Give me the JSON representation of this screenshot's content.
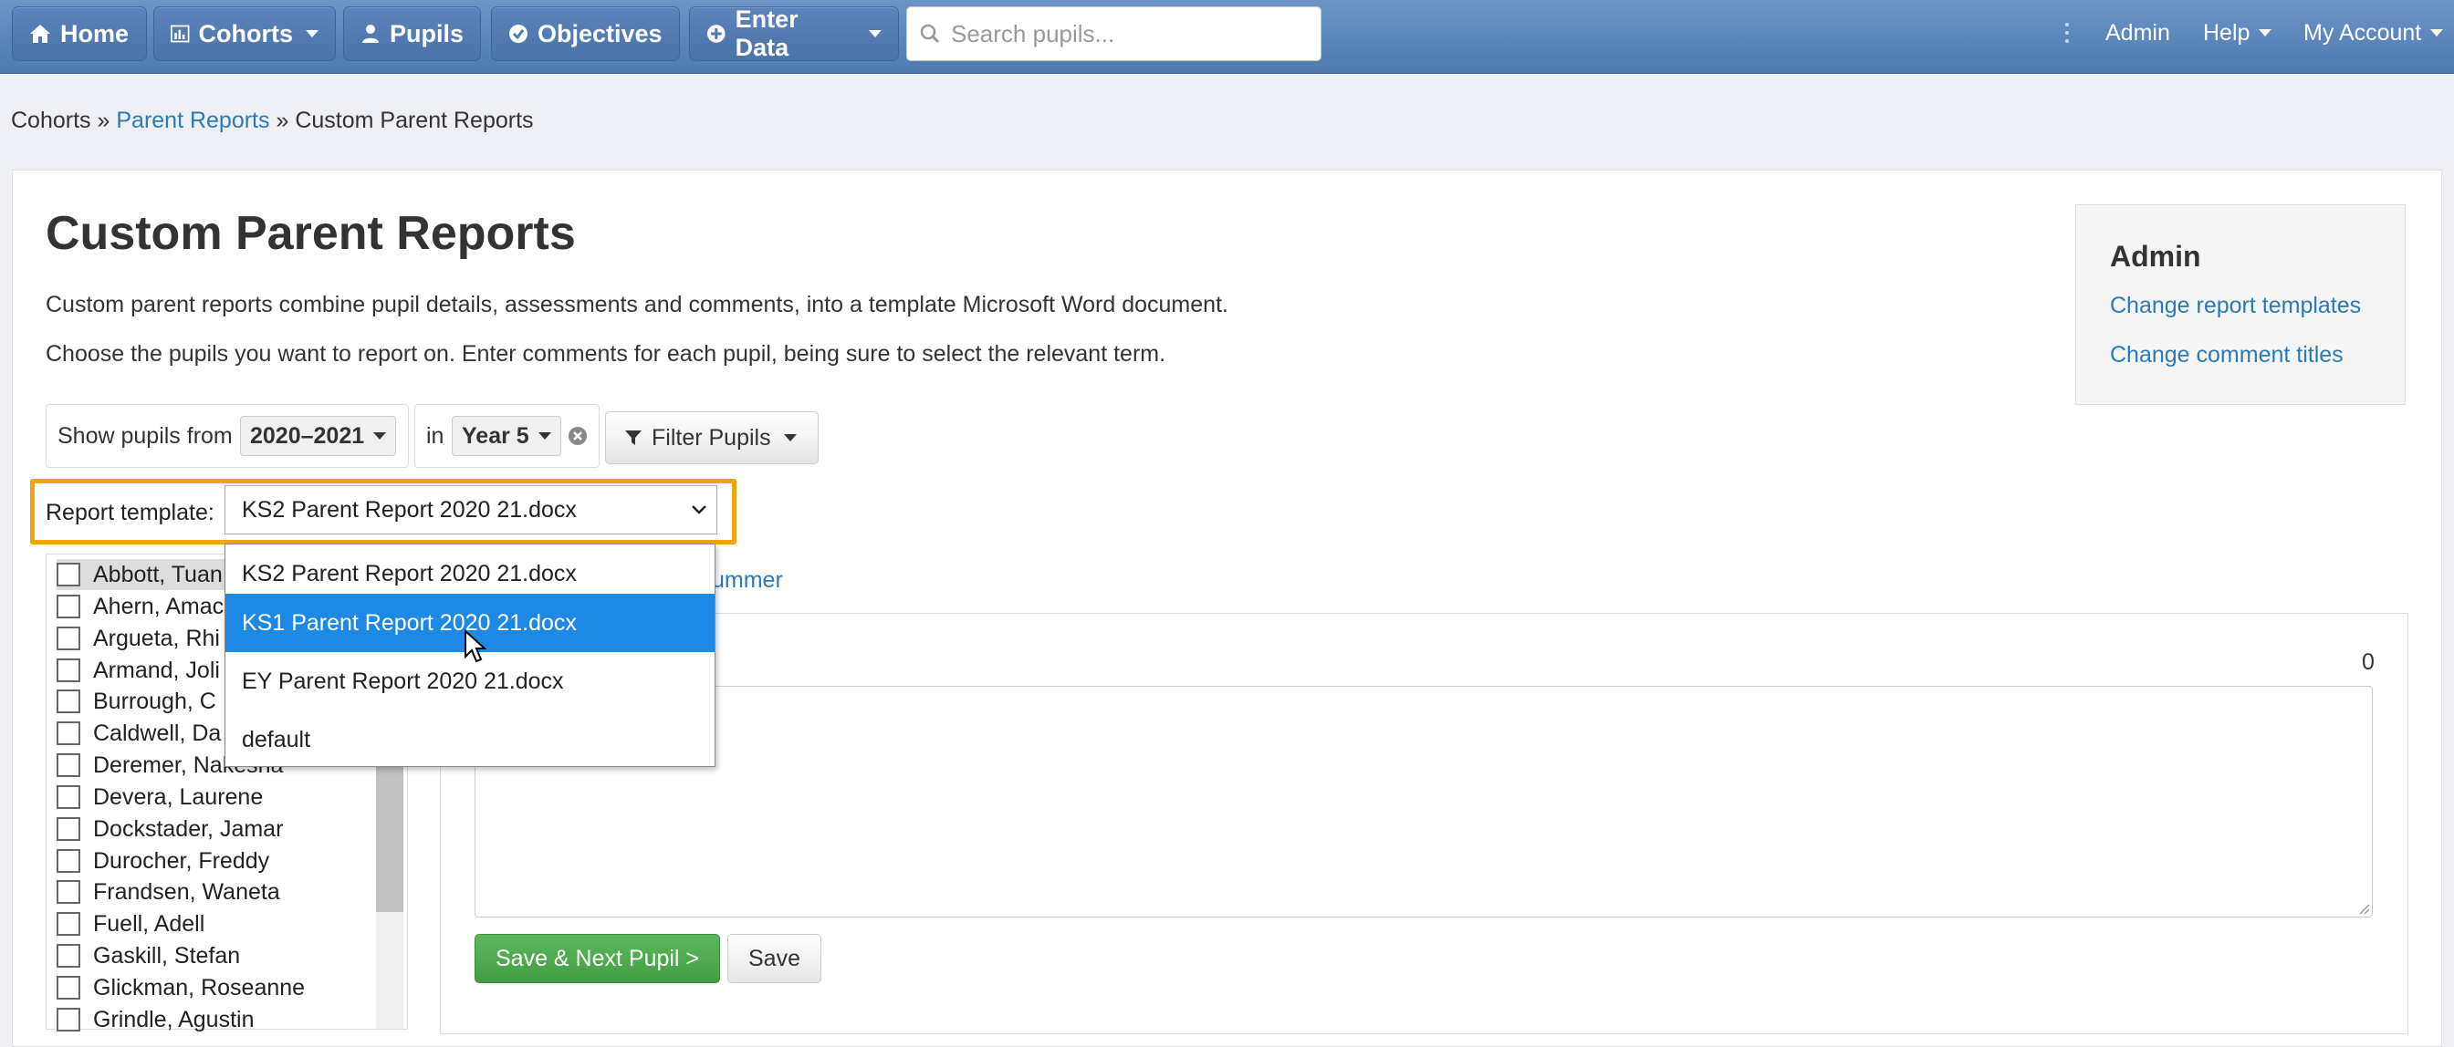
{
  "nav": {
    "home": "Home",
    "cohorts": "Cohorts",
    "pupils": "Pupils",
    "objectives": "Objectives",
    "enter_data": "Enter Data",
    "search_placeholder": "Search pupils...",
    "admin": "Admin",
    "help": "Help",
    "my_account": "My Account"
  },
  "breadcrumb": {
    "cohorts": "Cohorts",
    "sep": "»",
    "parent_reports": "Parent Reports",
    "current": "Custom Parent Reports"
  },
  "page": {
    "title": "Custom Parent Reports",
    "desc1": "Custom parent reports combine pupil details, assessments and comments, into a template Microsoft Word document.",
    "desc2": "Choose the pupils you want to report on. Enter comments for each pupil, being sure to select the relevant term."
  },
  "admin_box": {
    "title": "Admin",
    "link1": "Change report templates",
    "link2": "Change comment titles"
  },
  "filters": {
    "show_from_label": "Show pupils from",
    "year_value": "2020–2021",
    "in_label": "in",
    "group_value": "Year 5",
    "filter_button": "Filter Pupils"
  },
  "template": {
    "label": "Report template:",
    "selected": "KS2 Parent Report 2020 21.docx",
    "options": [
      "KS2 Parent Report 2020 21.docx",
      "KS1 Parent Report 2020 21.docx",
      "EY Parent Report 2020 21.docx",
      "default"
    ],
    "highlighted_index": 1
  },
  "term_link_partial": "ummer",
  "char_count": "0",
  "pupils": [
    "Abbott, Tuan",
    "Ahern, Amac",
    "Argueta, Rhi",
    "Armand, Joli",
    "Burrough, C",
    "Caldwell, Da",
    "Deremer, Nakesha",
    "Devera, Laurene",
    "Dockstader, Jamar",
    "Durocher, Freddy",
    "Frandsen, Waneta",
    "Fuell, Adell",
    "Gaskill, Stefan",
    "Glickman, Roseanne",
    "Grindle, Agustin"
  ],
  "buttons": {
    "save_next": "Save & Next Pupil >",
    "save": "Save"
  }
}
